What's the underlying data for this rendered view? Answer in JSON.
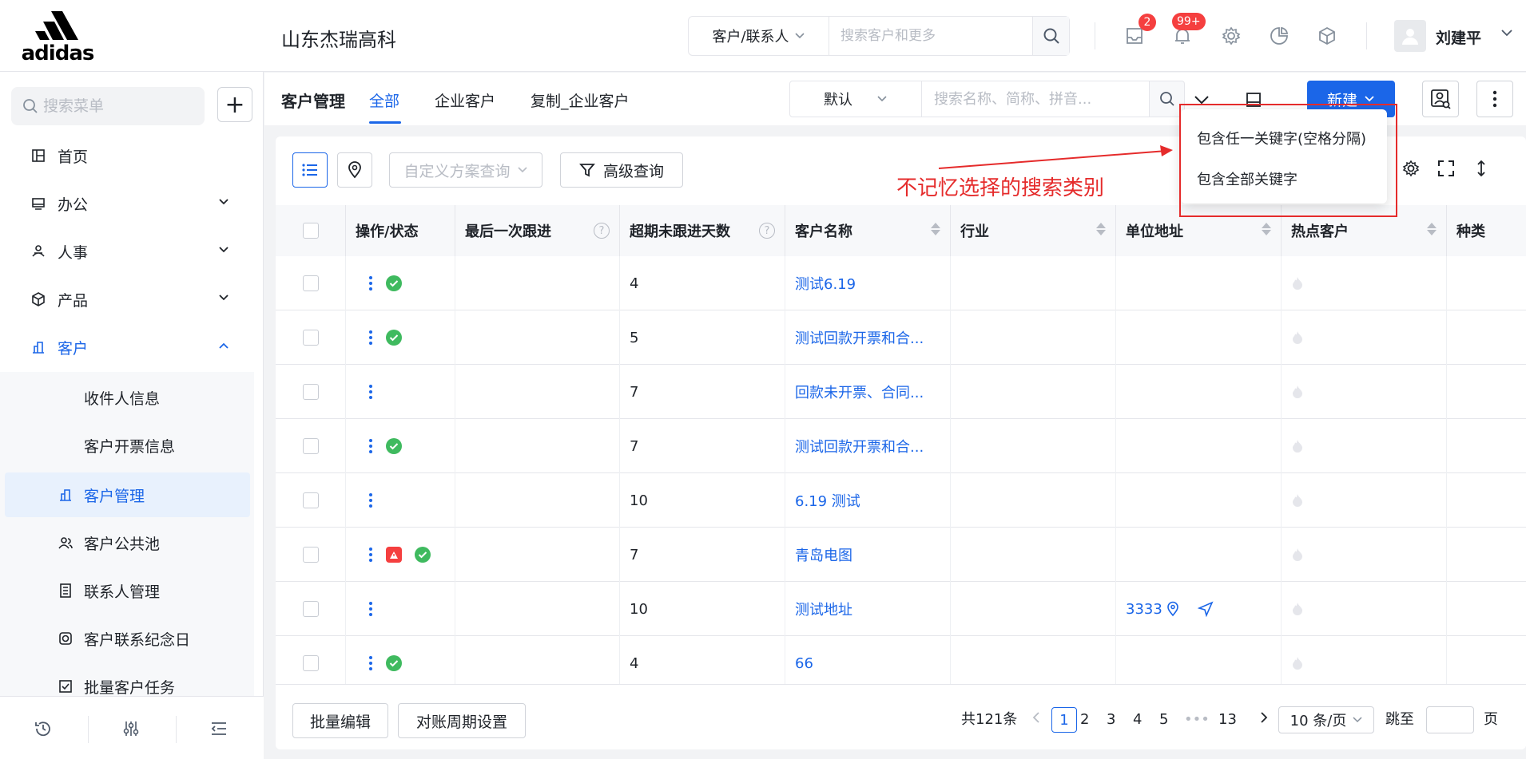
{
  "header": {
    "logo_text": "adidas",
    "company": "山东杰瑞高科",
    "search_type": "客户/联系人",
    "search_placeholder": "搜索客户和更多",
    "inbox_badge": "2",
    "notify_badge": "99+",
    "user_name": "刘建平"
  },
  "sidebar": {
    "search_placeholder": "搜索菜单",
    "add_label": "+",
    "items": [
      {
        "label": "首页",
        "icon": "home-icon"
      },
      {
        "label": "办公",
        "icon": "office-icon"
      },
      {
        "label": "人事",
        "icon": "personnel-icon"
      },
      {
        "label": "产品",
        "icon": "product-icon"
      },
      {
        "label": "客户",
        "icon": "customer-icon"
      }
    ],
    "sub_items": [
      {
        "label": "收件人信息"
      },
      {
        "label": "客户开票信息"
      },
      {
        "label": "客户管理",
        "icon": "building-icon"
      },
      {
        "label": "客户公共池",
        "icon": "users-icon"
      },
      {
        "label": "联系人管理",
        "icon": "contacts-icon"
      },
      {
        "label": "客户联系纪念日",
        "icon": "anniversary-icon"
      },
      {
        "label": "批量客户任务",
        "icon": "task-icon"
      }
    ]
  },
  "module": {
    "title": "客户管理",
    "tabs": [
      "全部",
      "企业客户",
      "复制_企业客户"
    ],
    "scheme": "默认",
    "list_search_placeholder": "搜索名称、简称、拼音...",
    "new_label": "新建"
  },
  "toolbar": {
    "custom_query_placeholder": "自定义方案查询",
    "advanced_query": "高级查询"
  },
  "annotation": "不记忆选择的搜索类别",
  "popup": {
    "options": [
      "包含任一关键字(空格分隔)",
      "包含全部关键字"
    ]
  },
  "table": {
    "columns": [
      "操作/状态",
      "最后一次跟进",
      "超期未跟进天数",
      "客户名称",
      "行业",
      "单位地址",
      "热点客户",
      "种类"
    ],
    "rows": [
      {
        "status": [
          "ok"
        ],
        "days": "4",
        "name": "测试6.19",
        "address": ""
      },
      {
        "status": [
          "ok"
        ],
        "days": "5",
        "name": "测试回款开票和合...",
        "address": ""
      },
      {
        "status": [],
        "days": "7",
        "name": "回款未开票、合同...",
        "address": ""
      },
      {
        "status": [
          "ok"
        ],
        "days": "7",
        "name": "测试回款开票和合...",
        "address": ""
      },
      {
        "status": [],
        "days": "10",
        "name": "6.19 测试",
        "address": ""
      },
      {
        "status": [
          "warn",
          "ok"
        ],
        "days": "7",
        "name": "青岛电图",
        "address": ""
      },
      {
        "status": [],
        "days": "10",
        "name": "测试地址",
        "address": "3333"
      },
      {
        "status": [
          "ok"
        ],
        "days": "4",
        "name": "66",
        "address": ""
      }
    ]
  },
  "footer": {
    "batch_edit": "批量编辑",
    "period_setting": "对账周期设置",
    "total": "共121条",
    "pages": [
      "1",
      "2",
      "3",
      "4",
      "5",
      "•••",
      "13"
    ],
    "current_page": "1",
    "page_size": "10 条/页",
    "jump_label": "跳至",
    "page_unit": "页"
  },
  "colors": {
    "primary": "#1b66e8",
    "success": "#3fba5f",
    "danger": "#f53f3f",
    "annotation": "#e52b2b"
  }
}
